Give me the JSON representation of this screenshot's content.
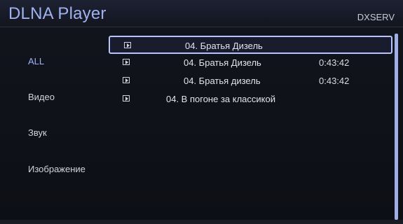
{
  "header": {
    "title": "DLNA Player",
    "server": "DXSERV"
  },
  "sidebar": {
    "items": [
      {
        "label": "ALL",
        "active": true
      },
      {
        "label": "Видео",
        "active": false
      },
      {
        "label": "Звук",
        "active": false
      },
      {
        "label": "Изображение",
        "active": false
      }
    ]
  },
  "list": {
    "rows": [
      {
        "icon": "play-file-icon",
        "title": "04. Братья Дизель",
        "duration": "",
        "selected": true
      },
      {
        "icon": "play-file-icon",
        "title": "04. Братья Дизель",
        "duration": "0:43:42",
        "selected": false
      },
      {
        "icon": "play-file-icon",
        "title": "04. Братья дизель",
        "duration": "0:43:42",
        "selected": false
      },
      {
        "icon": "play-file-icon",
        "title": "04. В погоне за классикой",
        "duration": "",
        "selected": false
      }
    ]
  },
  "colors": {
    "accent": "#9fb2ee",
    "selection_border": "#b7c2ff",
    "background": "#0d0f15"
  }
}
